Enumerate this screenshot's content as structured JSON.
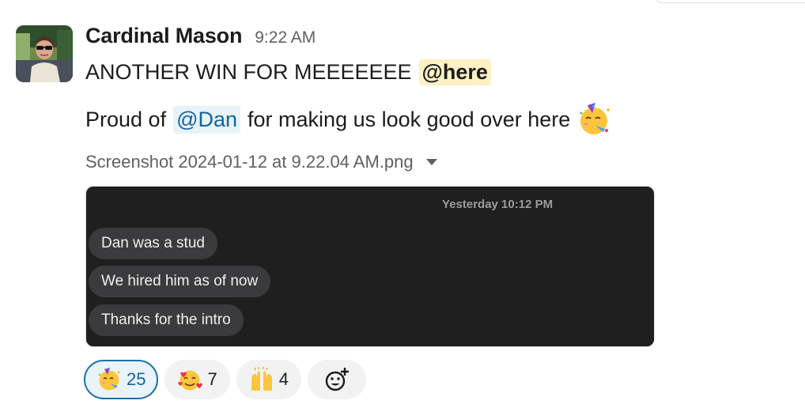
{
  "message": {
    "author": "Cardinal Mason",
    "timestamp": "9:22 AM",
    "line1_text": "ANOTHER WIN FOR MEEEEEEE",
    "line1_mention": "@here",
    "line2_prefix": "Proud of",
    "line2_mention": "@Dan",
    "line2_suffix": "for making us look good over here",
    "line2_emoji": "partying-face-emoji"
  },
  "attachment": {
    "filename": "Screenshot 2024-01-12 at 9.22.04 AM.png",
    "screenshot_timestamp": "Yesterday 10:12 PM",
    "bubbles": [
      "Dan was a stud",
      "We hired him as of now",
      "Thanks for the intro"
    ]
  },
  "reactions": [
    {
      "emoji": "partying-face",
      "count": "25",
      "active": true
    },
    {
      "emoji": "smiling-face-with-hearts",
      "count": "7",
      "active": false
    },
    {
      "emoji": "raising-hands",
      "count": "4",
      "active": false
    },
    {
      "emoji": "add-reaction",
      "count": "",
      "active": false
    }
  ],
  "colors": {
    "mention_here_bg": "#fdf0c3",
    "mention_user_bg": "#e8f3f9",
    "mention_user_text": "#1264a3",
    "active_reaction_border": "#1d6fa5"
  }
}
